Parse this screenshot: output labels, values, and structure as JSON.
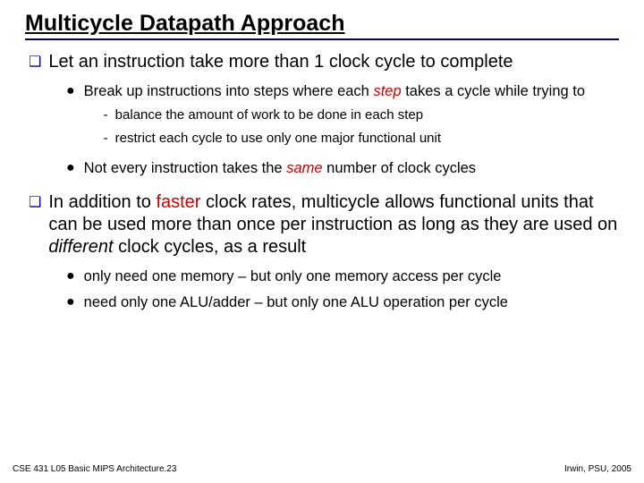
{
  "title": "Multicycle Datapath Approach",
  "q1": {
    "text_a": "Let an instruction take more than 1 clock cycle to complete",
    "l1_a": "Break up instructions into steps where each ",
    "l1_accent": "step",
    "l1_b": " takes a cycle while trying to",
    "d1": "balance the amount of work to be done in each step",
    "d2": "restrict each cycle to use only one major functional unit",
    "l2_a": "Not every instruction takes the ",
    "l2_accent": "same",
    "l2_b": " number of clock cycles"
  },
  "q2": {
    "a": "In addition to ",
    "accent": "faster",
    "b": " clock rates, multicycle allows functional units that can be used more than once per instruction as long as they are used on ",
    "italic": "different",
    "c": " clock cycles, as a result",
    "l1": "only need one memory – but only one memory access per cycle",
    "l2": "need only one ALU/adder – but only one ALU operation per cycle"
  },
  "footer": {
    "left": "CSE 431  L05 Basic MIPS Architecture.23",
    "right": "Irwin, PSU, 2005"
  }
}
